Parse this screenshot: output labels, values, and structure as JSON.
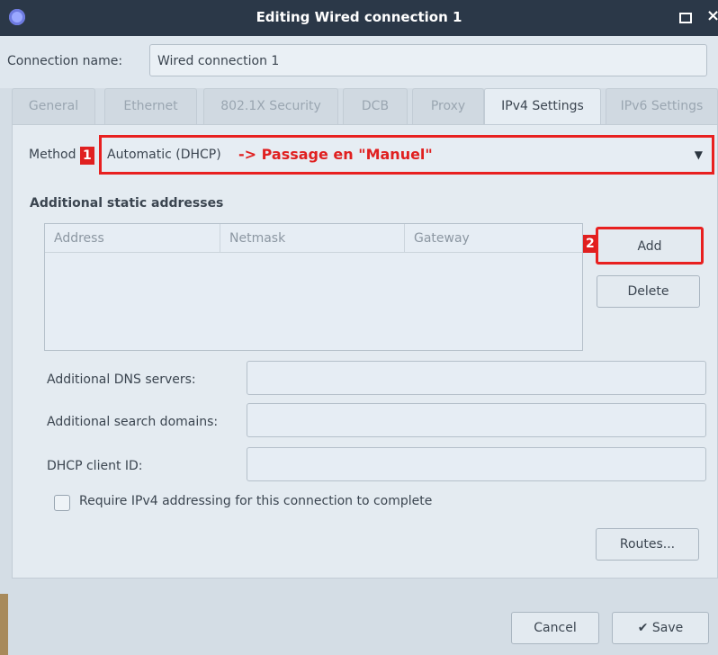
{
  "window": {
    "title": "Editing Wired connection 1"
  },
  "connection": {
    "label": "Connection name:",
    "value": "Wired connection 1"
  },
  "tabs": [
    {
      "label": "General"
    },
    {
      "label": "Ethernet"
    },
    {
      "label": "802.1X Security"
    },
    {
      "label": "DCB"
    },
    {
      "label": "Proxy"
    },
    {
      "label": "IPv4 Settings"
    },
    {
      "label": "IPv6 Settings"
    }
  ],
  "active_tab": "IPv4 Settings",
  "method": {
    "label": "Method",
    "value": "Automatic (DHCP)",
    "annotation": "-> Passage en \"Manuel\"",
    "badge": "1"
  },
  "addresses": {
    "title": "Additional static addresses",
    "columns": [
      "Address",
      "Netmask",
      "Gateway"
    ],
    "add_label": "Add",
    "add_badge": "2",
    "delete_label": "Delete"
  },
  "fields": {
    "dns_label": "Additional DNS servers:",
    "search_label": "Additional search domains:",
    "dhcp_label": "DHCP client ID:"
  },
  "require_ipv4_label": "Require IPv4 addressing for this connection to complete",
  "buttons": {
    "routes": "Routes...",
    "cancel": "Cancel",
    "save": "Save",
    "save_icon": "✔"
  },
  "colors": {
    "titlebar": "#2b3848",
    "annotation_red": "#e02020"
  }
}
